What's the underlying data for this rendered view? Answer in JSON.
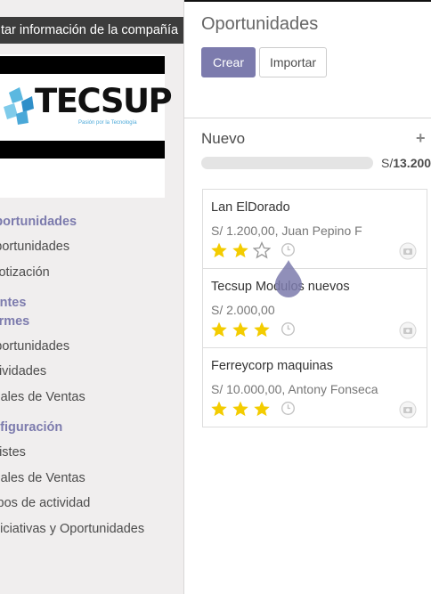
{
  "sidebar": {
    "company_tooltip": "Editar información de la compañía",
    "logo": {
      "text": "TECSUP",
      "tagline": "Pasión por la Tecnología"
    },
    "sections": [
      {
        "heading": "Oportunidades",
        "items": [
          "Oportunidades",
          "Cotización"
        ]
      },
      {
        "heading": "Clientes",
        "items": []
      },
      {
        "heading": "Informes",
        "items": [
          "Oportunidades",
          "Actividades",
          "Canales de Ventas"
        ]
      },
      {
        "heading": "Configuración",
        "items": [
          "Listes",
          "Canales de Ventas",
          "Tipos de actividad",
          "Iniciativas y Oportunidades"
        ]
      }
    ]
  },
  "main": {
    "title": "Oportunidades",
    "create_label": "Crear",
    "import_label": "Importar",
    "column": {
      "title": "Nuevo",
      "add_symbol": "+",
      "total_currency": "S/",
      "total_amount": "13.200"
    },
    "cards": [
      {
        "name": "Lan ElDorado",
        "sub": "S/ 1.200,00, Juan Pepino F",
        "stars": 2
      },
      {
        "name": "Tecsup Modulos nuevos",
        "sub": "S/ 2.000,00",
        "stars": 3
      },
      {
        "name": "Ferreycorp maquinas",
        "sub": "S/ 10.000,00, Antony Fonseca",
        "stars": 3
      }
    ]
  },
  "colors": {
    "accent": "#7c7bad",
    "star": "#f3cc00",
    "tooltip_bg": "#3c3c3c"
  }
}
